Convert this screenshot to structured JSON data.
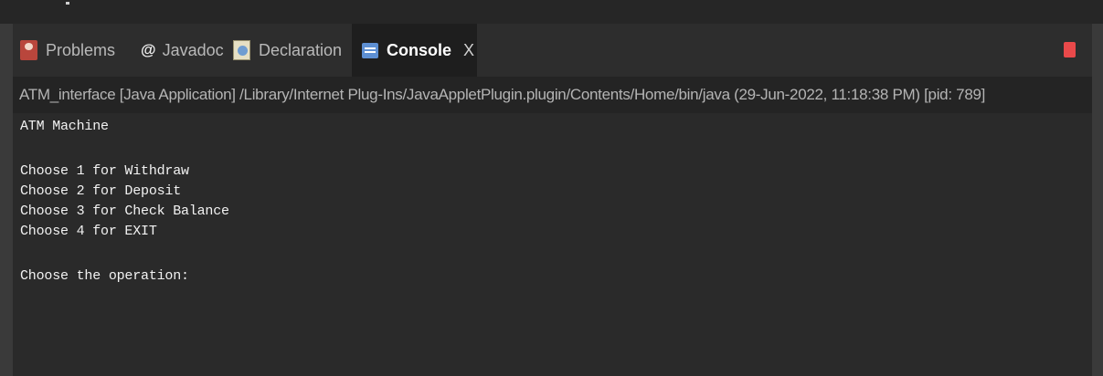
{
  "tabs": [
    {
      "label": "Problems",
      "icon": "problems-icon"
    },
    {
      "label": "Javadoc",
      "icon": "javadoc-icon",
      "glyph": "@"
    },
    {
      "label": "Declaration",
      "icon": "declaration-icon"
    },
    {
      "label": "Console",
      "icon": "console-icon",
      "active": true,
      "close": "X"
    }
  ],
  "toolbar": {
    "terminate_icon": "terminate-icon",
    "terminate_color": "#e9494a"
  },
  "console": {
    "launch_info": "ATM_interface [Java Application] /Library/Internet Plug-Ins/JavaAppletPlugin.plugin/Contents/Home/bin/java  (29-Jun-2022, 11:18:38 PM) [pid: 789]",
    "lines": [
      "ATM Machine",
      "",
      "Choose 1 for Withdraw",
      "Choose 2 for Deposit",
      "Choose 3 for Check Balance",
      "Choose 4 for EXIT",
      "",
      "Choose the operation:"
    ]
  },
  "colors": {
    "background": "#2c2c2c",
    "active_tab": "#1e1e1e",
    "accent": "#5d8fd3"
  }
}
